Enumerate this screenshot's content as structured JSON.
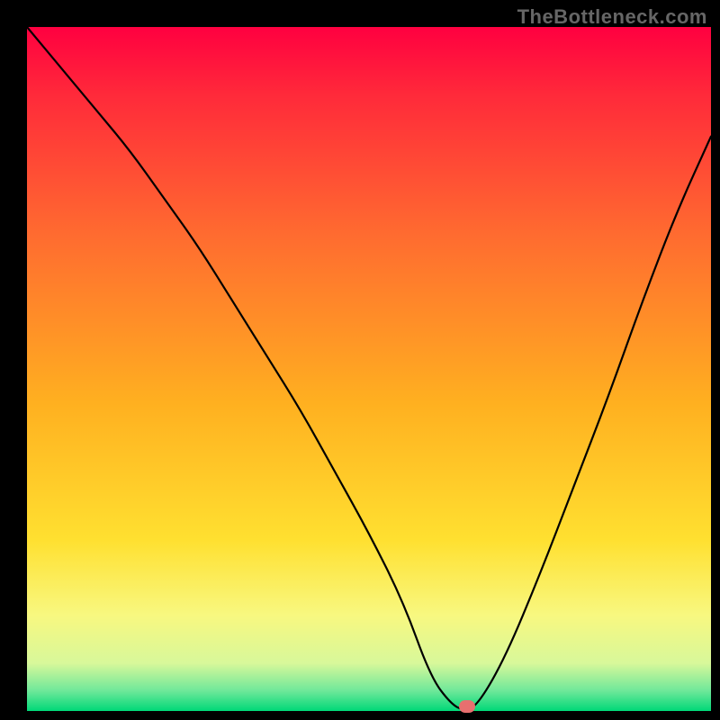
{
  "attribution": "TheBottleneck.com",
  "chart_data": {
    "type": "line",
    "title": "",
    "xlabel": "",
    "ylabel": "",
    "xlim": [
      0,
      100
    ],
    "ylim": [
      0,
      100
    ],
    "x": [
      0,
      5,
      10,
      15,
      20,
      25,
      30,
      35,
      40,
      45,
      50,
      55,
      59,
      62,
      64,
      66,
      70,
      75,
      80,
      85,
      90,
      95,
      100
    ],
    "values": [
      100,
      94,
      88,
      82,
      75,
      68,
      60,
      52,
      44,
      35,
      26,
      16,
      5,
      1,
      0,
      1,
      8,
      20,
      33,
      46,
      60,
      73,
      84
    ],
    "gradient_stops": [
      {
        "pct": 0,
        "color": "#ff0040"
      },
      {
        "pct": 10,
        "color": "#ff2a3a"
      },
      {
        "pct": 30,
        "color": "#ff6a30"
      },
      {
        "pct": 55,
        "color": "#ffb020"
      },
      {
        "pct": 75,
        "color": "#ffe030"
      },
      {
        "pct": 86,
        "color": "#f8f880"
      },
      {
        "pct": 93,
        "color": "#d8f89a"
      },
      {
        "pct": 97,
        "color": "#70e89a"
      },
      {
        "pct": 100,
        "color": "#00d878"
      }
    ],
    "marker": {
      "x": 64.3,
      "y": 0,
      "width_pct": 2.4
    },
    "grid": false,
    "legend": null
  }
}
